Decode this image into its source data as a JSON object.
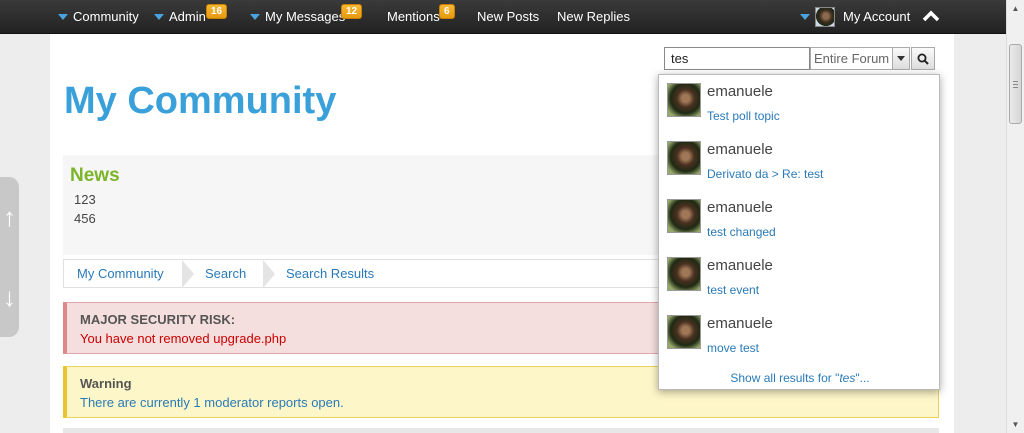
{
  "nav": {
    "community": "Community",
    "admin": "Admin",
    "admin_badge": "16",
    "messages": "My Messages",
    "messages_badge": "12",
    "mentions": "Mentions",
    "mentions_badge": "6",
    "new_posts": "New Posts",
    "new_replies": "New Replies",
    "account": "My Account"
  },
  "page_title": "My Community",
  "search": {
    "value": "tes",
    "scope": "Entire Forum"
  },
  "news": {
    "title": "News",
    "lines": [
      "123",
      "456"
    ]
  },
  "breadcrumb": [
    "My Community",
    "Search",
    "Search Results"
  ],
  "alerts": {
    "error_title": "MAJOR SECURITY RISK:",
    "error_msg": "You have not removed upgrade.php",
    "warn_title": "Warning",
    "warn_msg": "There are currently 1 moderator reports open."
  },
  "results": [
    {
      "user": "emanuele",
      "topic": "Test poll topic"
    },
    {
      "user": "emanuele",
      "topic": "Derivato da > Re: test"
    },
    {
      "user": "emanuele",
      "topic": "test changed"
    },
    {
      "user": "emanuele",
      "topic": "test event"
    },
    {
      "user": "emanuele",
      "topic": "move test"
    }
  ],
  "show_all": {
    "prefix": "Show all results for \"",
    "term": "tes",
    "suffix": "\"..."
  },
  "side_scroller": {
    "up": "↑",
    "down": "↓"
  },
  "colors": {
    "accent": "#3aa0da",
    "news": "#7cb42a",
    "link": "#2a7ab8",
    "badge": "#f0a81e",
    "error": "#cc0000"
  }
}
